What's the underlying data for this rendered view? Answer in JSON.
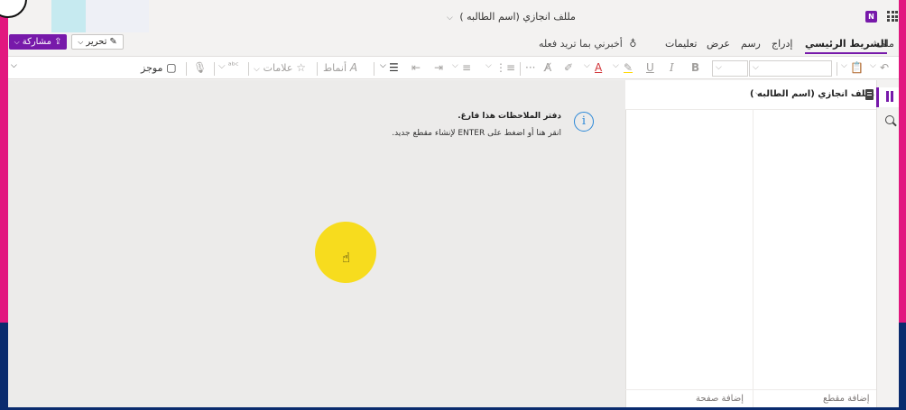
{
  "app": {
    "document_title": "مللف انجازي (اسم الطالبه )",
    "app_icon_letter": "N",
    "brand_color": "#7719aa"
  },
  "actions": {
    "share_label": "مشاركة",
    "edit_label": "تحرير"
  },
  "tabs": [
    {
      "label": "ملف",
      "active": false
    },
    {
      "label": "الشريط الرئيسي",
      "active": true
    },
    {
      "label": "إدراج",
      "active": false
    },
    {
      "label": "رسم",
      "active": false
    },
    {
      "label": "عرض",
      "active": false
    },
    {
      "label": "تعليمات",
      "active": false
    }
  ],
  "tell_me": "أخبرني بما تريد فعله",
  "ribbon": {
    "bold": "B",
    "italic": "I",
    "underline": "U",
    "font_color_glyph": "A",
    "format_painter_glyph": "A",
    "more": "···",
    "styles_label": "أنماط",
    "tags_label": "علامات",
    "summary_label": "موجز",
    "style_glyph": "A"
  },
  "notebook_info": {
    "title": "دفتر الملاحظات هذا فارغ.",
    "subtitle": "انقر هنا أو اضغط على ENTER لإنشاء مقطع جديد."
  },
  "notebook_pane": {
    "notebook_name": "مللف انجازي (اسم الطالبه )",
    "add_page": "إضافة صفحة",
    "add_section": "إضافة مقطع"
  }
}
